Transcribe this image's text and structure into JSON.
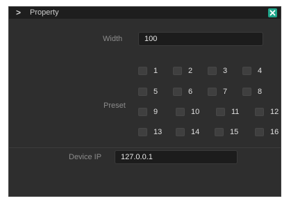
{
  "titlebar": {
    "chevron_glyph": ">",
    "title": "Property",
    "close_icon": "close-x-icon",
    "close_color": "#1ea58a"
  },
  "width": {
    "label": "Width",
    "value": "100"
  },
  "preset": {
    "label": "Preset",
    "options": [
      {
        "label": "1",
        "checked": false
      },
      {
        "label": "2",
        "checked": false
      },
      {
        "label": "3",
        "checked": false
      },
      {
        "label": "4",
        "checked": false
      },
      {
        "label": "5",
        "checked": false
      },
      {
        "label": "6",
        "checked": false
      },
      {
        "label": "7",
        "checked": false
      },
      {
        "label": "8",
        "checked": false
      },
      {
        "label": "9",
        "checked": false
      },
      {
        "label": "10",
        "checked": false
      },
      {
        "label": "11",
        "checked": false
      },
      {
        "label": "12",
        "checked": false
      },
      {
        "label": "13",
        "checked": false
      },
      {
        "label": "14",
        "checked": false
      },
      {
        "label": "15",
        "checked": false
      },
      {
        "label": "16",
        "checked": false
      }
    ]
  },
  "device_ip": {
    "label": "Device IP",
    "value": "127.0.0.1"
  },
  "colors": {
    "panel_bg": "#2e2e2e",
    "titlebar_bg": "#1e1e1e",
    "field_bg": "#1c1c1c",
    "accent": "#1ea58a"
  }
}
